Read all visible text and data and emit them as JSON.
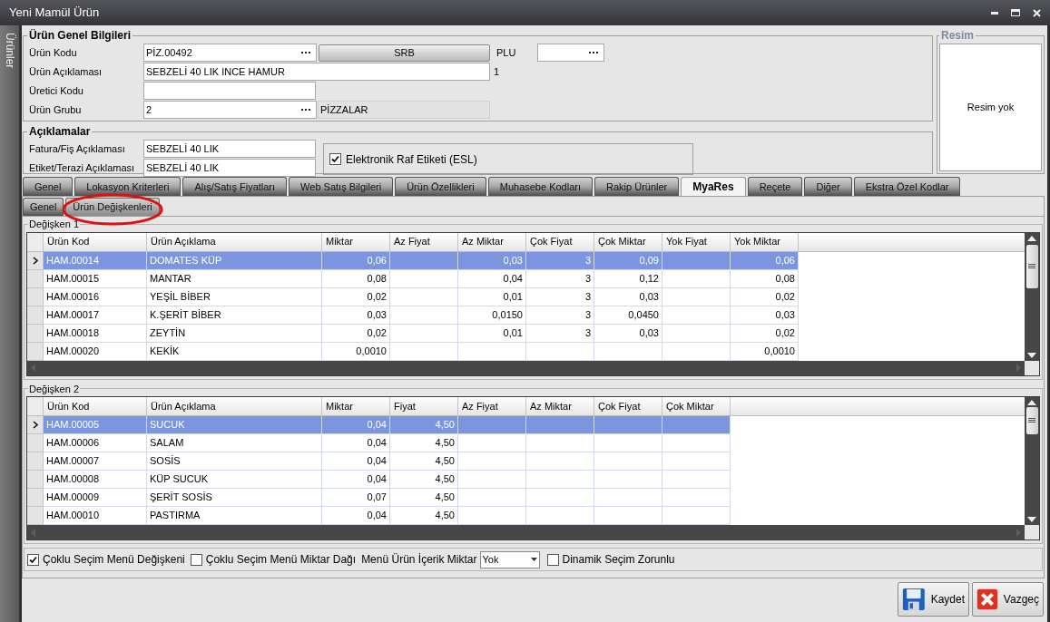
{
  "window": {
    "title": "Yeni Mamül Ürün"
  },
  "side_tab": {
    "label": "Ürünler"
  },
  "general": {
    "title": "Ürün Genel Bilgileri",
    "product_code": {
      "label": "Ürün Kodu",
      "value": "PİZ.00492"
    },
    "code_button": {
      "label": "SRB"
    },
    "plu": {
      "label": "PLU"
    },
    "description": {
      "label": "Ürün Açıklaması",
      "value": "SEBZELİ 40 LIK INCE HAMUR",
      "note": "1"
    },
    "producer_code": {
      "label": "Üretici Kodu"
    },
    "group": {
      "label": "Ürün Grubu",
      "value": "2",
      "name": "PİZZALAR"
    }
  },
  "image": {
    "title": "Resim",
    "empty_text": "Resim yok"
  },
  "descriptions": {
    "title": "Açıklamalar",
    "invoice": {
      "label": "Fatura/Fiş Açıklaması",
      "value": "SEBZELİ 40 LIK"
    },
    "label": {
      "label": "Etiket/Terazi Açıklaması",
      "value": "SEBZELİ 40 LIK"
    },
    "esl": {
      "label": "Elektronik Raf Etiketi (ESL)",
      "checked": true
    }
  },
  "tabs": [
    {
      "label": "Genel",
      "selected": false
    },
    {
      "label": "Lokasyon Kriterleri",
      "selected": false
    },
    {
      "label": "Alış/Satış Fiyatları",
      "selected": false
    },
    {
      "label": "Web Satış Bilgileri",
      "selected": false
    },
    {
      "label": "Ürün Özellikleri",
      "selected": false
    },
    {
      "label": "Muhasebe Kodları",
      "selected": false
    },
    {
      "label": "Rakip Ürünler",
      "selected": false
    },
    {
      "label": "MyaRes",
      "selected": true
    },
    {
      "label": "Reçete",
      "selected": false
    },
    {
      "label": "Diğer",
      "selected": false
    },
    {
      "label": "Ekstra Özel Kodlar",
      "selected": false
    }
  ],
  "subtabs": [
    {
      "label": "Genel",
      "selected": false
    },
    {
      "label": "Ürün Değişkenleri",
      "selected": true
    }
  ],
  "grids": [
    {
      "title": "Değişken 1",
      "columns": [
        {
          "label": "Ürün Kod",
          "kind": "text"
        },
        {
          "label": "Ürün Açıklama",
          "kind": "text"
        },
        {
          "label": "Miktar",
          "kind": "number"
        },
        {
          "label": "Az Fiyat",
          "kind": "number"
        },
        {
          "label": "Az Miktar",
          "kind": "number"
        },
        {
          "label": "Çok Fiyat",
          "kind": "number"
        },
        {
          "label": "Çok Miktar",
          "kind": "number"
        },
        {
          "label": "Yok Fiyat",
          "kind": "number"
        },
        {
          "label": "Yok Miktar",
          "kind": "number"
        }
      ],
      "rows": [
        {
          "selected": true,
          "cells": [
            "HAM.00014",
            "DOMATES KÜP",
            "0,06",
            null,
            "0,03",
            "3",
            "0,09",
            null,
            "0,06"
          ]
        },
        {
          "selected": false,
          "cells": [
            "HAM.00015",
            "MANTAR",
            "0,08",
            null,
            "0,04",
            "3",
            "0,12",
            null,
            "0,08"
          ]
        },
        {
          "selected": false,
          "cells": [
            "HAM.00016",
            "YEŞİL BİBER",
            "0,02",
            null,
            "0,01",
            "3",
            "0,03",
            null,
            "0,02"
          ]
        },
        {
          "selected": false,
          "cells": [
            "HAM.00017",
            "K.ŞERİT BİBER",
            "0,03",
            null,
            "0,0150",
            "3",
            "0,0450",
            null,
            "0,03"
          ]
        },
        {
          "selected": false,
          "cells": [
            "HAM.00018",
            "ZEYTİN",
            "0,02",
            null,
            "0,01",
            "3",
            "0,03",
            null,
            "0,02"
          ]
        },
        {
          "selected": false,
          "cells": [
            "HAM.00020",
            "KEKİK",
            "0,0010",
            null,
            null,
            null,
            null,
            null,
            "0,0010"
          ]
        }
      ]
    },
    {
      "title": "Değişken 2",
      "columns": [
        {
          "label": "Ürün Kod",
          "kind": "text"
        },
        {
          "label": "Ürün Açıklama",
          "kind": "text"
        },
        {
          "label": "Miktar",
          "kind": "number"
        },
        {
          "label": "Fiyat",
          "kind": "number"
        },
        {
          "label": "Az Fiyat",
          "kind": "number"
        },
        {
          "label": "Az Miktar",
          "kind": "number"
        },
        {
          "label": "Çok Fiyat",
          "kind": "number"
        },
        {
          "label": "Çok Miktar",
          "kind": "number"
        }
      ],
      "rows": [
        {
          "selected": true,
          "cells": [
            "HAM.00005",
            "SUCUK",
            "0,04",
            "4,50",
            null,
            null,
            null,
            null
          ]
        },
        {
          "selected": false,
          "cells": [
            "HAM.00006",
            "SALAM",
            "0,04",
            "4,50",
            null,
            null,
            null,
            null
          ]
        },
        {
          "selected": false,
          "cells": [
            "HAM.00007",
            "SOSİS",
            "0,04",
            "4,50",
            null,
            null,
            null,
            null
          ]
        },
        {
          "selected": false,
          "cells": [
            "HAM.00008",
            "KÜP SUCUK",
            "0,04",
            "4,50",
            null,
            null,
            null,
            null
          ]
        },
        {
          "selected": false,
          "cells": [
            "HAM.00009",
            "ŞERİT SOSİS",
            "0,07",
            "4,50",
            null,
            null,
            null,
            null
          ]
        },
        {
          "selected": false,
          "cells": [
            "HAM.00010",
            "PASTIRMA",
            "0,04",
            "4,50",
            null,
            null,
            null,
            null
          ]
        }
      ]
    }
  ],
  "options": [
    {
      "kind": "checkbox",
      "label": "Çoklu Seçim Menü Değişkeni",
      "checked": true
    },
    {
      "kind": "checkbox",
      "label": "Çoklu Seçim Menü Miktar Dağı",
      "checked": false
    },
    {
      "kind": "dropdown",
      "label": "Menü Ürün İçerik Miktar",
      "value": "Yok"
    },
    {
      "kind": "checkbox",
      "label": "Dinamik Seçim Zorunlu",
      "checked": false
    }
  ],
  "buttons": [
    {
      "label": "Kaydet",
      "kind": "save"
    },
    {
      "label": "Vazgeç",
      "kind": "cancel"
    }
  ]
}
